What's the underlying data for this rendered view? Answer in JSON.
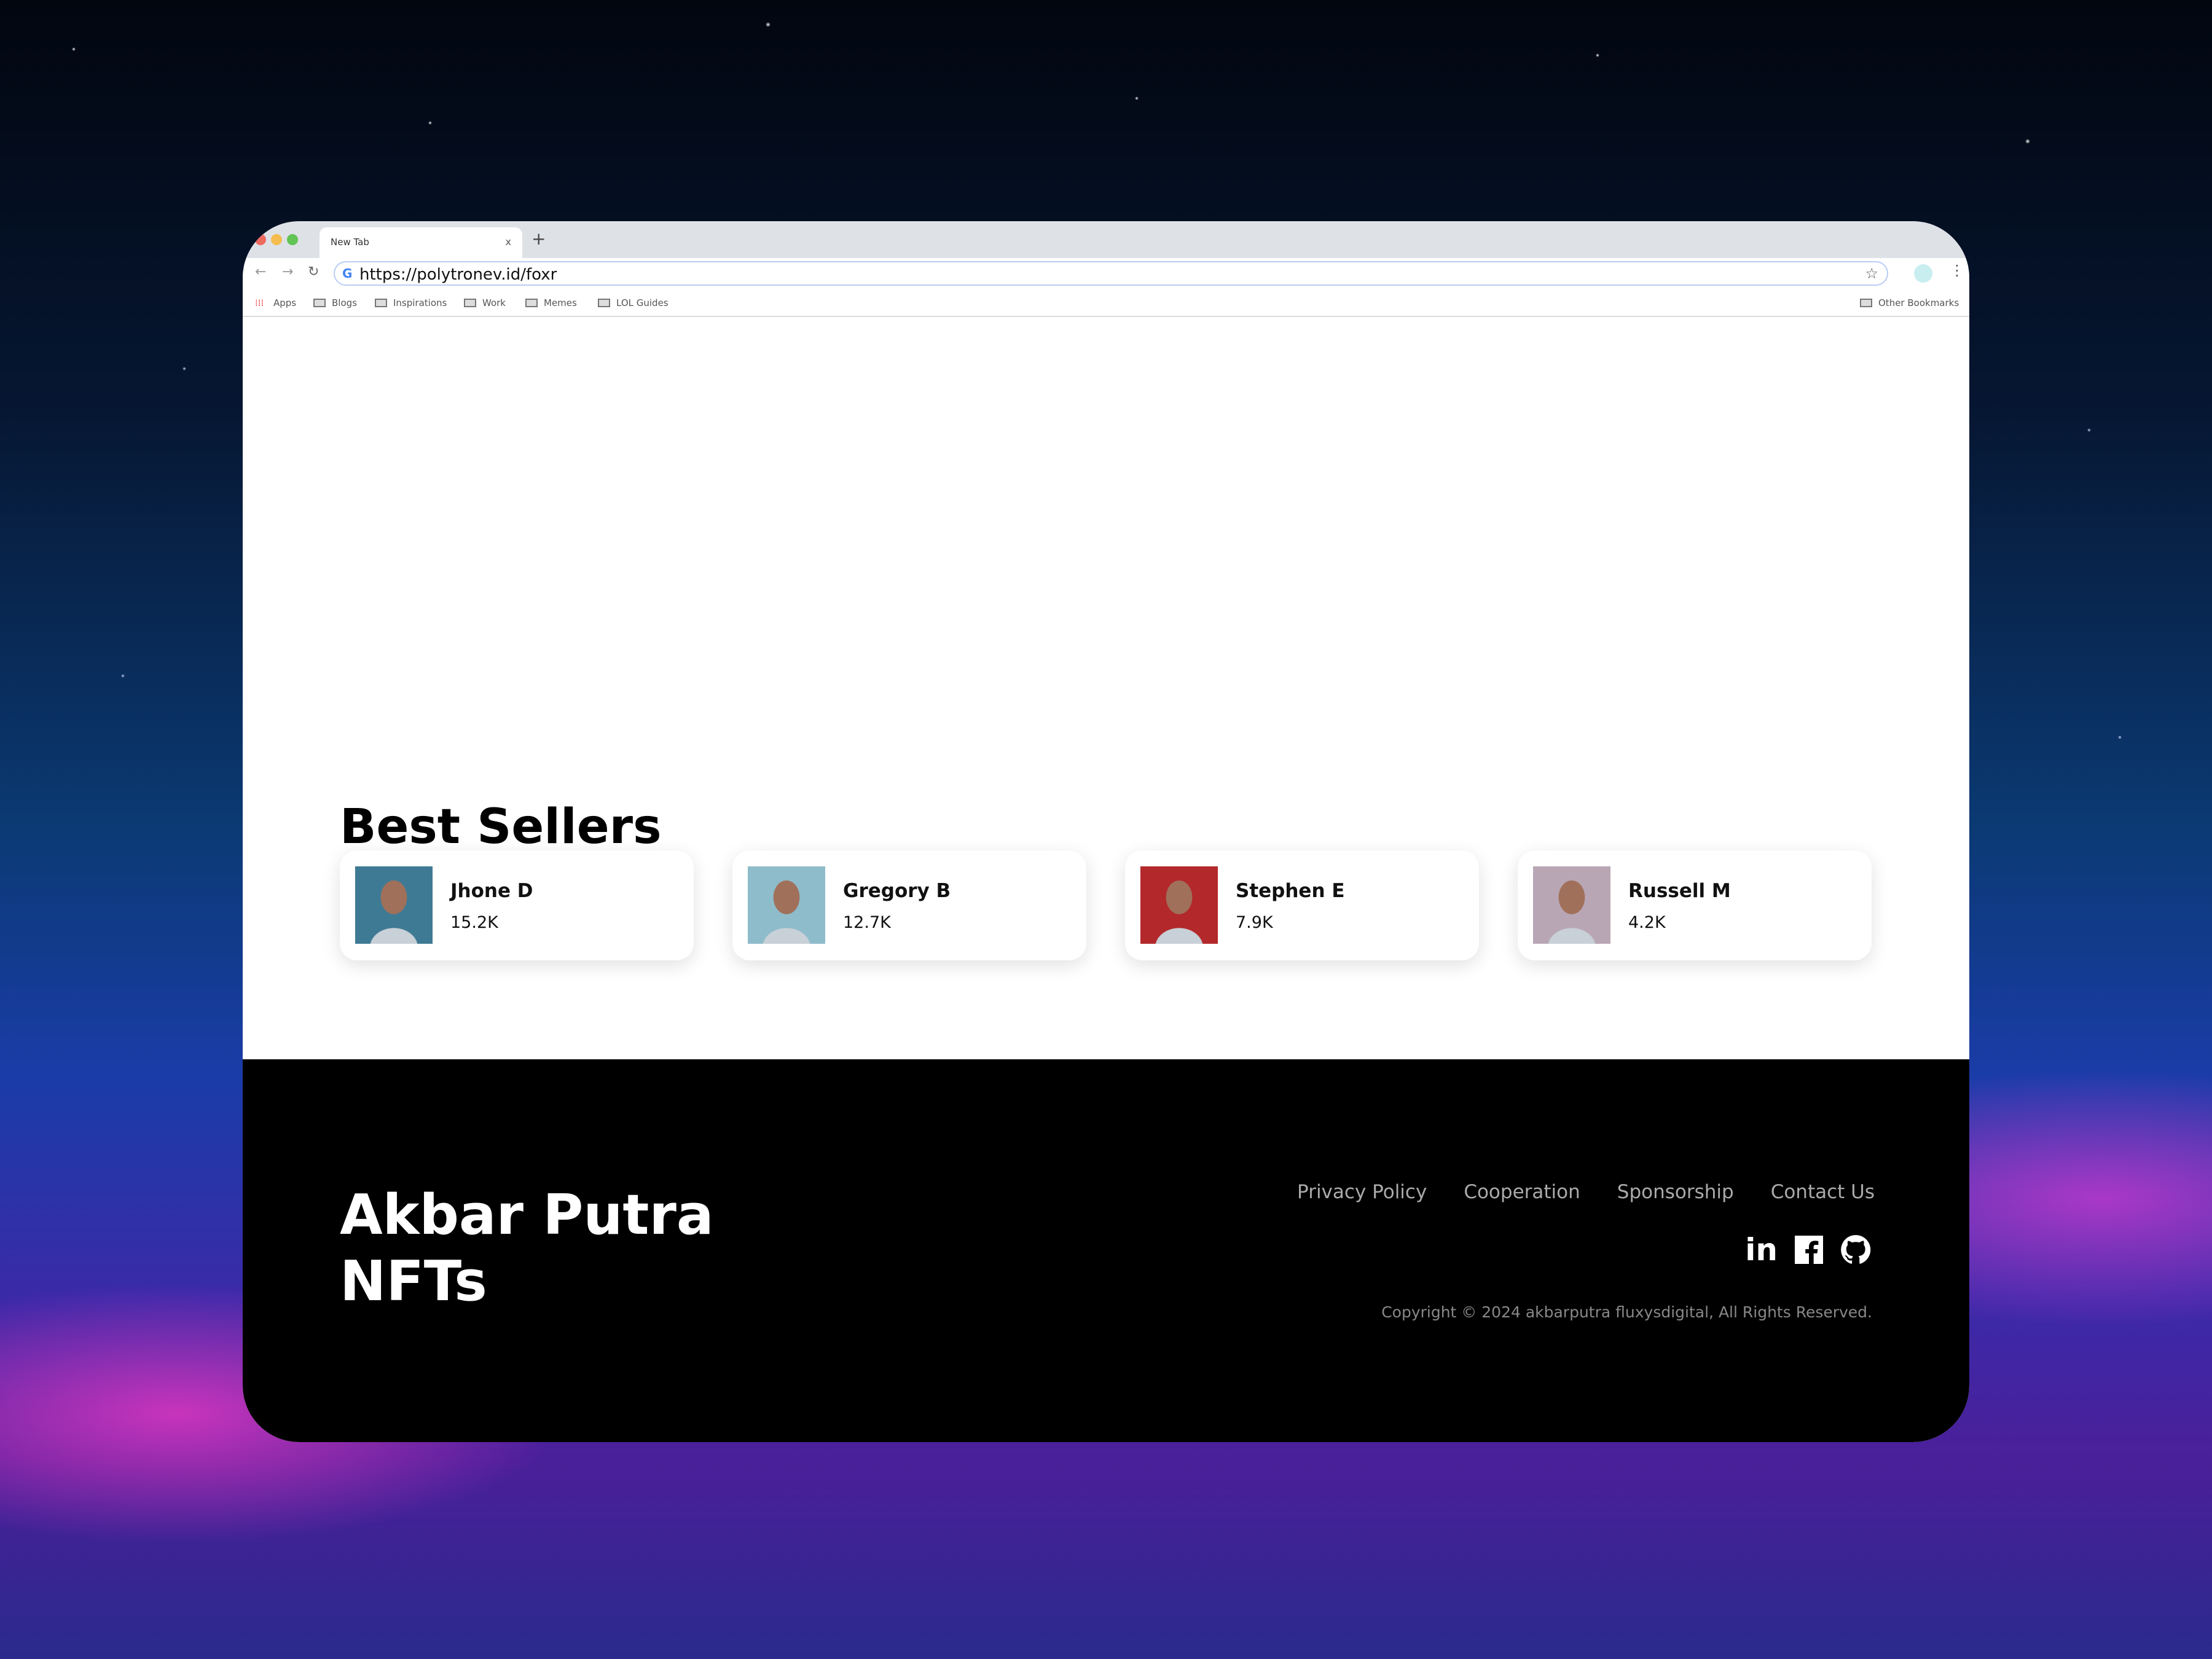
{
  "browser": {
    "tab_title": "New Tab",
    "tab_close": "x",
    "new_tab": "+",
    "url": "https://polytronev.id/foxr",
    "bookmarks": [
      "Apps",
      "Blogs",
      "Inspirations",
      "Work",
      "Memes",
      "LOL Guides"
    ],
    "other_bookmarks": "Other Bookmarks"
  },
  "main": {
    "heading": "Best Sellers",
    "sellers": [
      {
        "name": "Jhone D",
        "value": "15.2K",
        "color": "#3f7a94"
      },
      {
        "name": "Gregory B",
        "value": "12.7K",
        "color": "#8fbccb"
      },
      {
        "name": "Stephen E",
        "value": "7.9K",
        "color": "#b3282a"
      },
      {
        "name": "Russell M",
        "value": "4.2K",
        "color": "#b9a6b4"
      }
    ]
  },
  "footer": {
    "brand_line1": "Akbar Putra",
    "brand_line2": "NFTs",
    "links": [
      "Privacy Policy",
      "Cooperation",
      "Sponsorship",
      "Contact Us"
    ],
    "social": [
      "linkedin-icon",
      "facebook-icon",
      "github-icon"
    ],
    "copyright": "Copyright © 2024 akbarputra fluxysdigital, All Rights Reserved."
  }
}
